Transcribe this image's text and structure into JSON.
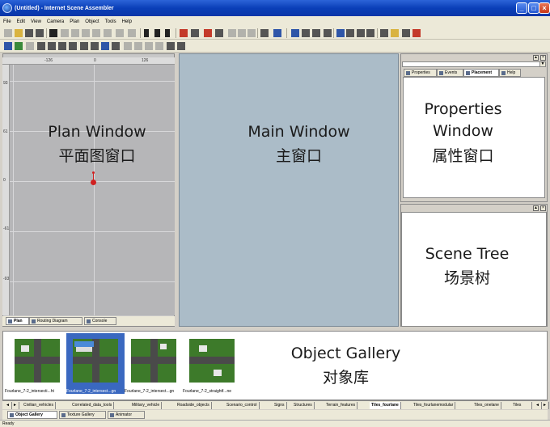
{
  "window": {
    "title": "(Untitled) - Internet Scene Assembler"
  },
  "menu": [
    "File",
    "Edit",
    "View",
    "Camera",
    "Plan",
    "Object",
    "Tools",
    "Help"
  ],
  "plan": {
    "ruler_top": [
      "-126",
      "0",
      "126"
    ],
    "ruler_left": [
      "93",
      "61",
      "0",
      "-61",
      "-93"
    ],
    "overlay_en": "Plan Window",
    "overlay_zh": "平面图窗口",
    "tabs": [
      "Plan",
      "Routing Diagram",
      "Console"
    ]
  },
  "main": {
    "overlay_en": "Main Window",
    "overlay_zh": "主窗口"
  },
  "properties": {
    "tabs": [
      "Properties",
      "Events",
      "Placement",
      "Help"
    ],
    "overlay_en_1": "Properties",
    "overlay_en_2": "Window",
    "overlay_zh": "属性窗口"
  },
  "scene_tree": {
    "overlay_en": "Scene Tree",
    "overlay_zh": "场景树"
  },
  "gallery": {
    "overlay_en": "Object Gallery",
    "overlay_zh": "对象库",
    "thumbs": [
      "Fourlane_7-2_intersecti...ht",
      "Fourlane_7-2_intersect...gn",
      "Fourlane_7-2_intersect...gn",
      "Fourlane_7-2_straightf...ne"
    ],
    "categories": [
      "Civilian_vehicles",
      "Correlated_data_tools",
      "Military_vehicle",
      "Roadside_objects",
      "Scenario_control",
      "Signs",
      "Structures",
      "Terrain_features",
      "Tiles_fourlane",
      "Tiles_fourlanemodular",
      "Tiles_onelane",
      "Tiles"
    ],
    "active_category": "Tiles_fourlane",
    "bottom_tabs": [
      "Object Gallery",
      "Texture Gallery",
      "Animator"
    ]
  },
  "status": {
    "text": "Ready"
  },
  "colors": {
    "title_bar": "#0a3fb8",
    "main_window_bg": "#abbcc8",
    "plan_grid_bg": "#b6b6b8",
    "tile_green": "#3d7a2a",
    "selection_blue": "#3a68c0"
  }
}
